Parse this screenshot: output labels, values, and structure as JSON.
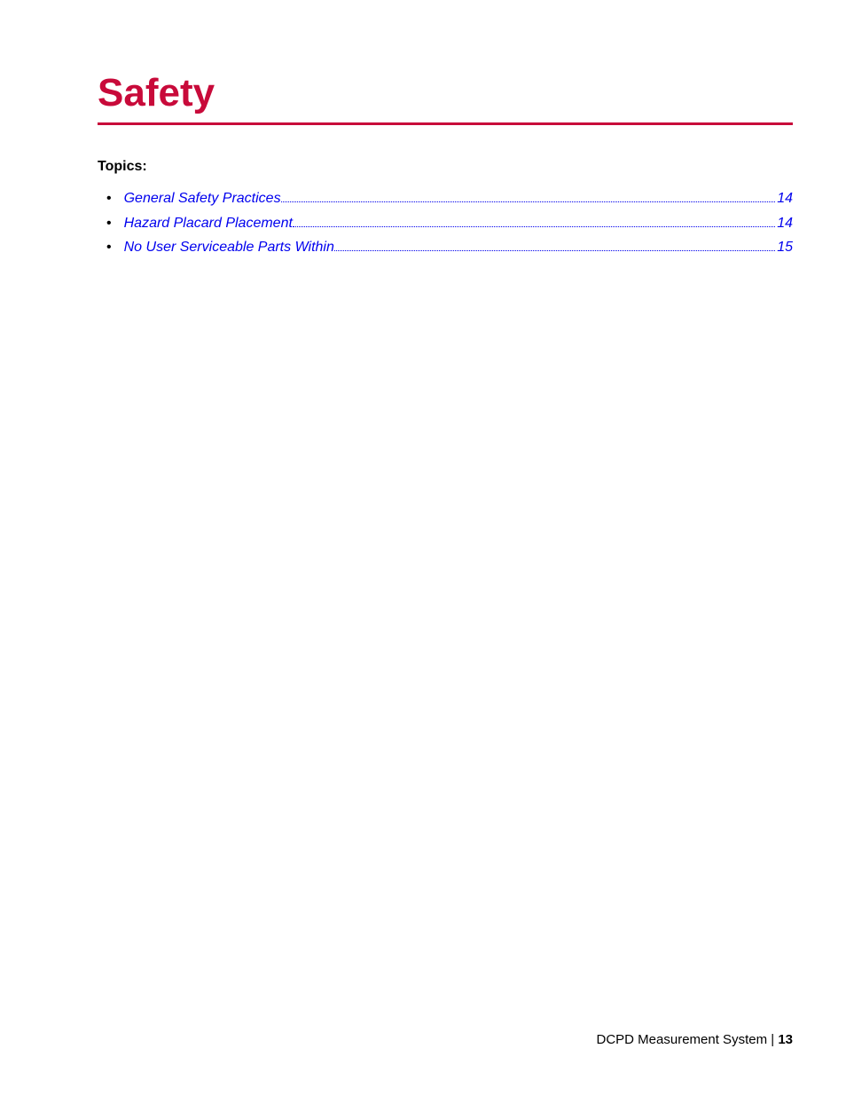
{
  "title": "Safety",
  "topics_label": "Topics:",
  "toc": [
    {
      "label": "General Safety Practices",
      "page": "14"
    },
    {
      "label": "Hazard Placard Placement",
      "page": "14"
    },
    {
      "label": "No User Serviceable Parts Within",
      "page": "15"
    }
  ],
  "footer": {
    "doc_name": "DCPD Measurement System",
    "separator": " | ",
    "page_number": "13"
  }
}
